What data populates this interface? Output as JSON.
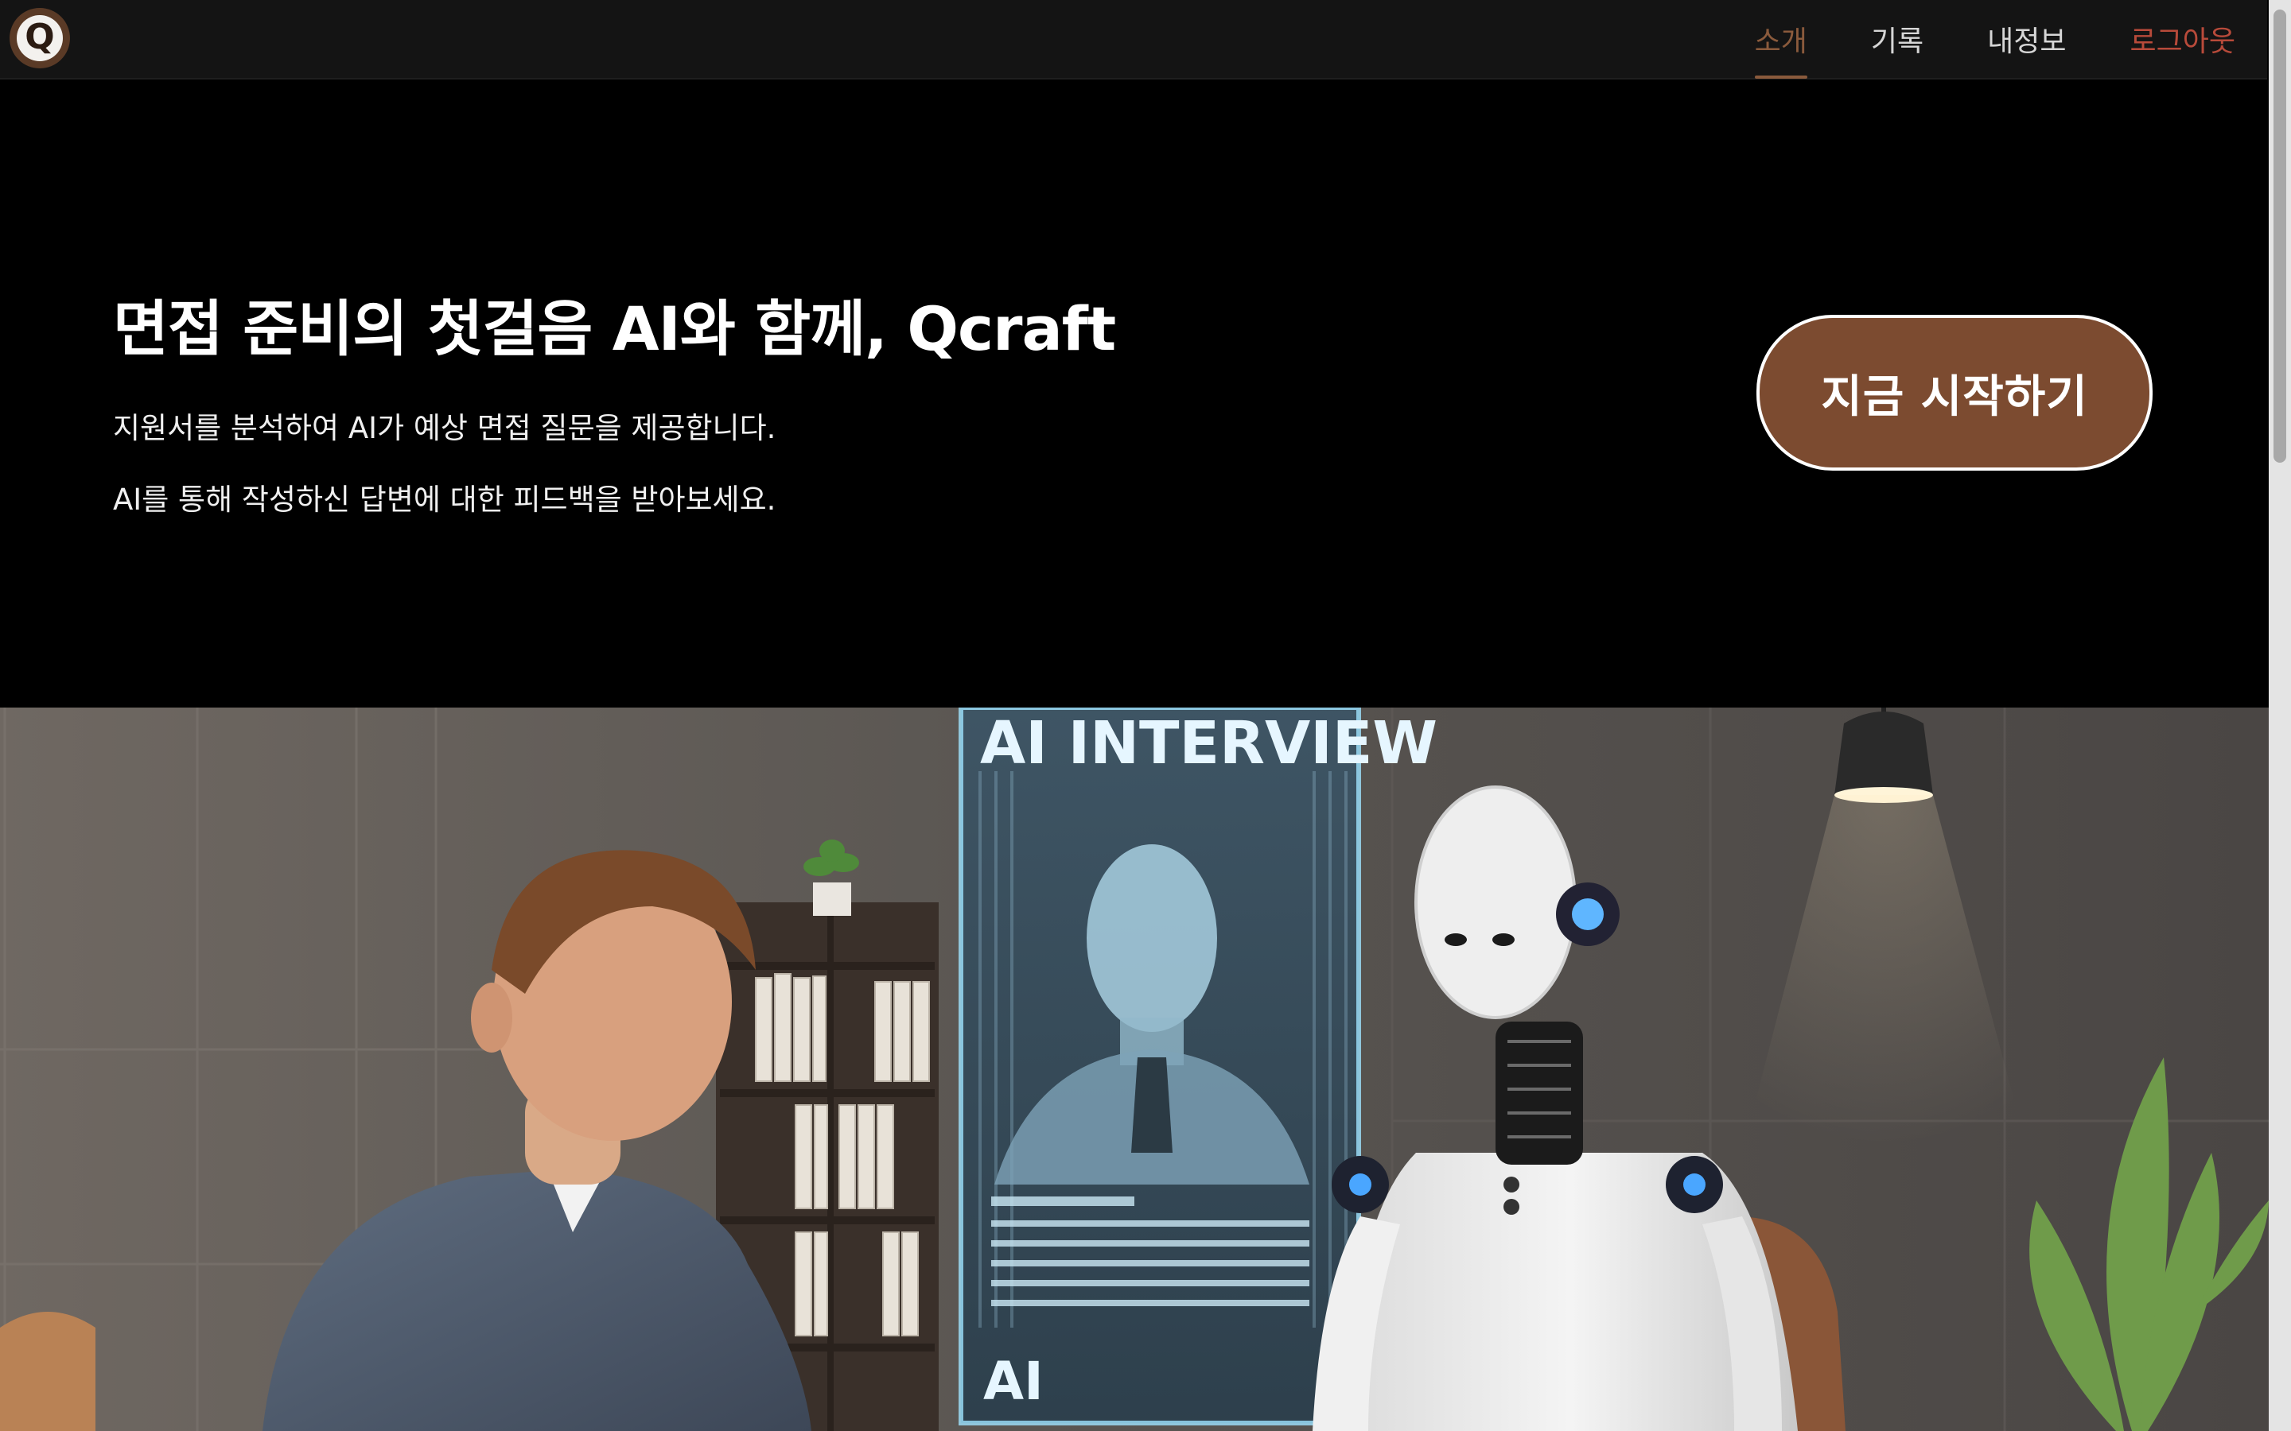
{
  "nav": {
    "logo_letter": "Q",
    "items": [
      {
        "label": "소개",
        "active": true
      },
      {
        "label": "기록",
        "active": false
      },
      {
        "label": "내정보",
        "active": false
      },
      {
        "label": "로그아웃",
        "active": false
      }
    ]
  },
  "hero": {
    "title": "면접 준비의 첫걸음 AI와 함께, Qcraft",
    "description_1": "지원서를 분석하여 AI가 예상 면접 질문을 제공합니다.",
    "description_2": "AI를 통해 작성하신 답변에 대한 피드백을 받아보세요.",
    "cta_label": "지금 시작하기"
  },
  "illustration": {
    "screen_title": "AI INTERVIEW",
    "screen_footer": "AI",
    "icon": "ai-interview-illustration"
  },
  "colors": {
    "accent_brown": "#7c4b30",
    "active_nav": "#8a5a3c",
    "logout": "#b84a3a",
    "navbar_bg": "#141414"
  }
}
